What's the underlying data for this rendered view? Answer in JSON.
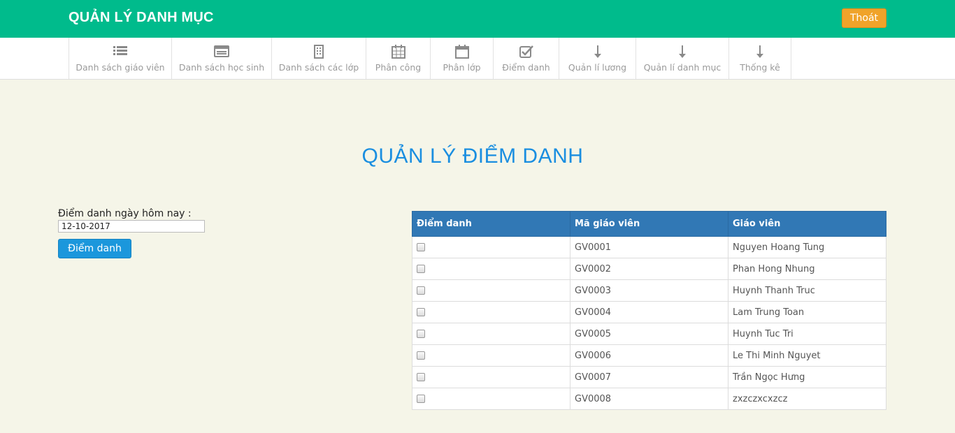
{
  "header": {
    "brand": "QUẢN LÝ DANH MỤC",
    "logout_label": "Thoát",
    "bg_color": "#00bb8c",
    "logout_color": "#f0a32a"
  },
  "nav": {
    "items": [
      {
        "label": "Danh sách giáo viên",
        "icon": "list-icon"
      },
      {
        "label": "Danh sách học sinh",
        "icon": "id-card-icon"
      },
      {
        "label": "Danh sách các lớp",
        "icon": "building-icon"
      },
      {
        "label": "Phân công",
        "icon": "calendar-grid-icon"
      },
      {
        "label": "Phân lớp",
        "icon": "calendar-icon"
      },
      {
        "label": "Điểm danh",
        "icon": "checkbox-icon"
      },
      {
        "label": "Quản lí lương",
        "icon": "arrow-down-icon"
      },
      {
        "label": "Quản lí danh mục",
        "icon": "arrow-down-icon"
      },
      {
        "label": "Thống kê",
        "icon": "arrow-down-icon"
      }
    ]
  },
  "main": {
    "title": "QUẢN LÝ ĐIỂM DANH",
    "title_color": "#1a8ee0",
    "date_label": "Điểm danh ngày hôm nay :",
    "date_value": "12-10-2017",
    "submit_label": "Điểm danh"
  },
  "table": {
    "headers": [
      "Điểm danh",
      "Mã giáo viên",
      "Giáo viên"
    ],
    "header_color": "#3178b5",
    "rows": [
      {
        "checked": false,
        "code": "GV0001",
        "name": "Nguyen Hoang Tung"
      },
      {
        "checked": false,
        "code": "GV0002",
        "name": "Phan Hong Nhung"
      },
      {
        "checked": false,
        "code": "GV0003",
        "name": "Huynh Thanh Truc"
      },
      {
        "checked": false,
        "code": "GV0004",
        "name": "Lam Trung Toan"
      },
      {
        "checked": false,
        "code": "GV0005",
        "name": "Huynh Tuc Tri"
      },
      {
        "checked": false,
        "code": "GV0006",
        "name": "Le Thi Minh Nguyet"
      },
      {
        "checked": false,
        "code": "GV0007",
        "name": "Trần Ngọc Hưng"
      },
      {
        "checked": false,
        "code": "GV0008",
        "name": "zxzczxcxzcz"
      }
    ]
  }
}
